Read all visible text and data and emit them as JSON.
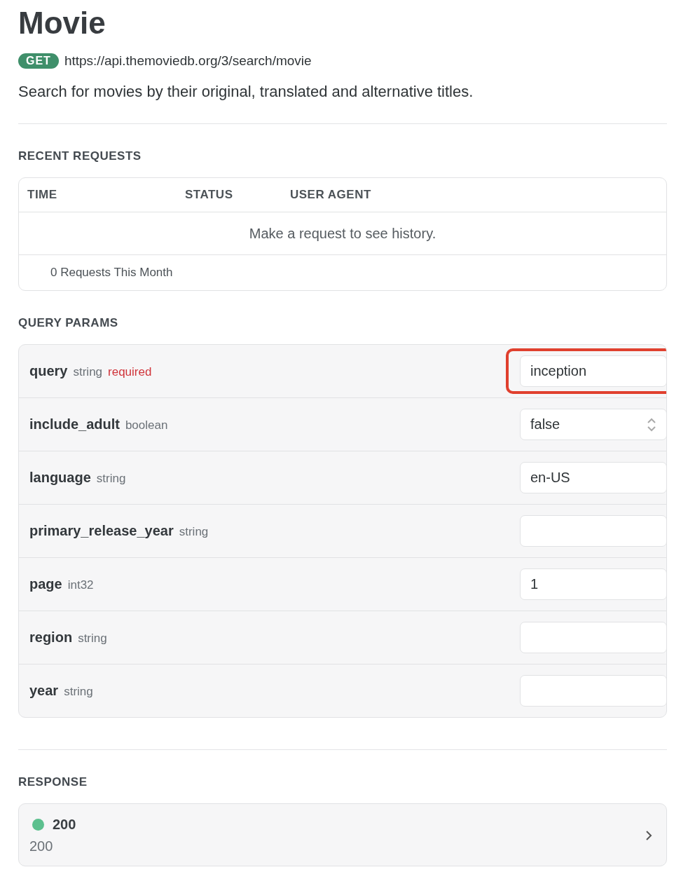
{
  "title": "Movie",
  "endpoint": {
    "method": "GET",
    "url": "https://api.themoviedb.org/3/search/movie"
  },
  "description": "Search for movies by their original, translated and alternative titles.",
  "recent_requests": {
    "heading": "RECENT REQUESTS",
    "columns": [
      "TIME",
      "STATUS",
      "USER AGENT"
    ],
    "empty_message": "Make a request to see history.",
    "footer": "0 Requests This Month"
  },
  "query_params": {
    "heading": "QUERY PARAMS",
    "params": [
      {
        "name": "query",
        "type": "string",
        "required": "required",
        "kind": "text",
        "value": "inception",
        "highlighted": true
      },
      {
        "name": "include_adult",
        "type": "boolean",
        "kind": "select",
        "value": "false",
        "highlighted": false
      },
      {
        "name": "language",
        "type": "string",
        "kind": "text",
        "value": "en-US",
        "highlighted": false
      },
      {
        "name": "primary_release_year",
        "type": "string",
        "kind": "text",
        "highlighted": false
      },
      {
        "name": "page",
        "type": "int32",
        "kind": "text",
        "value": "1",
        "highlighted": false
      },
      {
        "name": "region",
        "type": "string",
        "kind": "text",
        "highlighted": false
      },
      {
        "name": "year",
        "type": "string",
        "kind": "text",
        "highlighted": false
      }
    ]
  },
  "response": {
    "heading": "RESPONSE",
    "items": [
      {
        "code": "200",
        "description": "200",
        "color": "#5cc08e"
      }
    ]
  }
}
